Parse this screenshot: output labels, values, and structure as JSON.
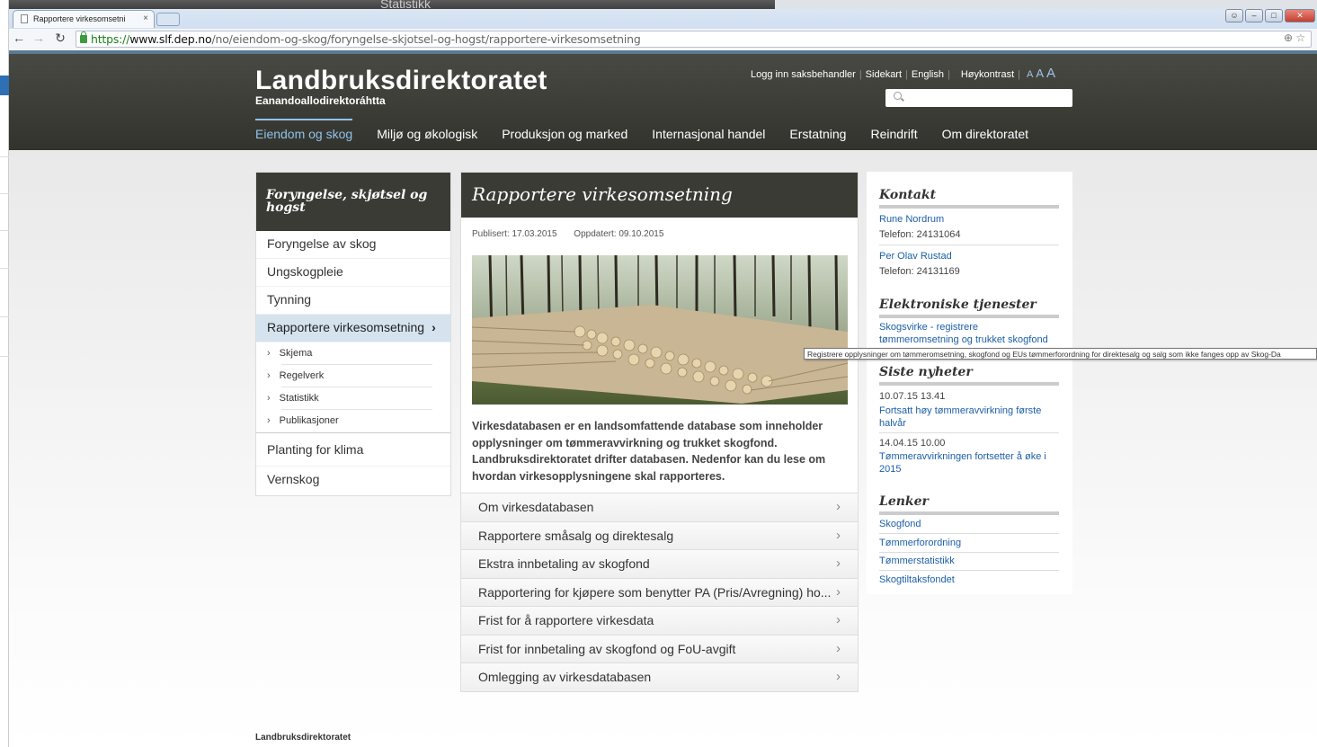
{
  "browser": {
    "tab_title": "Rapportere virkesomsetni",
    "url_protocol": "https://",
    "url_host": "www.slf.dep.no",
    "url_path": "/no/eiendom-og-skog/foryngelse-skjotsel-og-hogst/rapportere-virkesomsetning"
  },
  "background": {
    "behind_title": "Statistikk"
  },
  "header": {
    "logo": "Landbruksdirektoratet",
    "logo_sub": "Eanandoallodirektoráhtta",
    "util_links": [
      "Logg inn saksbehandler",
      "Sidekart",
      "English",
      "Høykontrast"
    ],
    "text_sizes": [
      "A",
      "A",
      "A"
    ]
  },
  "mainnav": [
    "Eiendom og skog",
    "Miljø og økologisk",
    "Produksjon og marked",
    "Internasjonal handel",
    "Erstatning",
    "Reindrift",
    "Om direktoratet"
  ],
  "leftmenu": {
    "title": "Foryngelse, skjøtsel og hogst",
    "items_top": [
      "Foryngelse av skog",
      "Ungskogpleie",
      "Tynning"
    ],
    "active": "Rapportere virkesomsetning",
    "sub_items": [
      "Skjema",
      "Regelverk",
      "Statistikk",
      "Publikasjoner"
    ],
    "items_bottom": [
      "Planting for klima",
      "Vernskog"
    ]
  },
  "main": {
    "title": "Rapportere virkesomsetning",
    "published": "Publisert: 17.03.2015",
    "updated": "Oppdatert: 09.10.2015",
    "intro": "Virkesdatabasen er en landsomfattende database som inneholder opplysninger om tømmeravvirkning og trukket skogfond. Landbruksdirektoratet drifter databasen. Nedenfor kan du lese om hvordan virkesopplysningene skal rapporteres.",
    "accordion": [
      "Om virkesdatabasen",
      "Rapportere småsalg og direktesalg",
      "Ekstra innbetaling av skogfond",
      "Rapportering for kjøpere som benytter PA (Pris/Avregning) ho...",
      "Frist for å rapportere virkesdata",
      "Frist for innbetaling av skogfond og FoU-avgift",
      "Omlegging av virkesdatabasen"
    ]
  },
  "right": {
    "contact_title": "Kontakt",
    "contacts": [
      {
        "name": "Rune Nordrum",
        "phone": "Telefon: 24131064"
      },
      {
        "name": "Per Olav Rustad",
        "phone": "Telefon: 24131169"
      }
    ],
    "eservices_title": "Elektroniske tjenester",
    "eservice_link": "Skogsvirke - registrere tømmeromsetning og trukket skogfond",
    "news_title": "Siste nyheter",
    "news": [
      {
        "date": "10.07.15 13.41",
        "title": "Fortsatt høy tømmeravvirkning første halvår"
      },
      {
        "date": "14.04.15 10.00",
        "title": "Tømmeravvirkningen fortsetter å øke i 2015"
      }
    ],
    "links_title": "Lenker",
    "links": [
      "Skogfond",
      "Tømmerforordning",
      "Tømmerstatistikk",
      "Skogtiltaksfondet"
    ]
  },
  "tooltip": "Registrere opplysninger om tømmeromsetning, skogfond og EUs tømmerforordning for direktesalg og salg som ikke fanges opp av Skog-Da",
  "footer": "Landbruksdirektoratet"
}
